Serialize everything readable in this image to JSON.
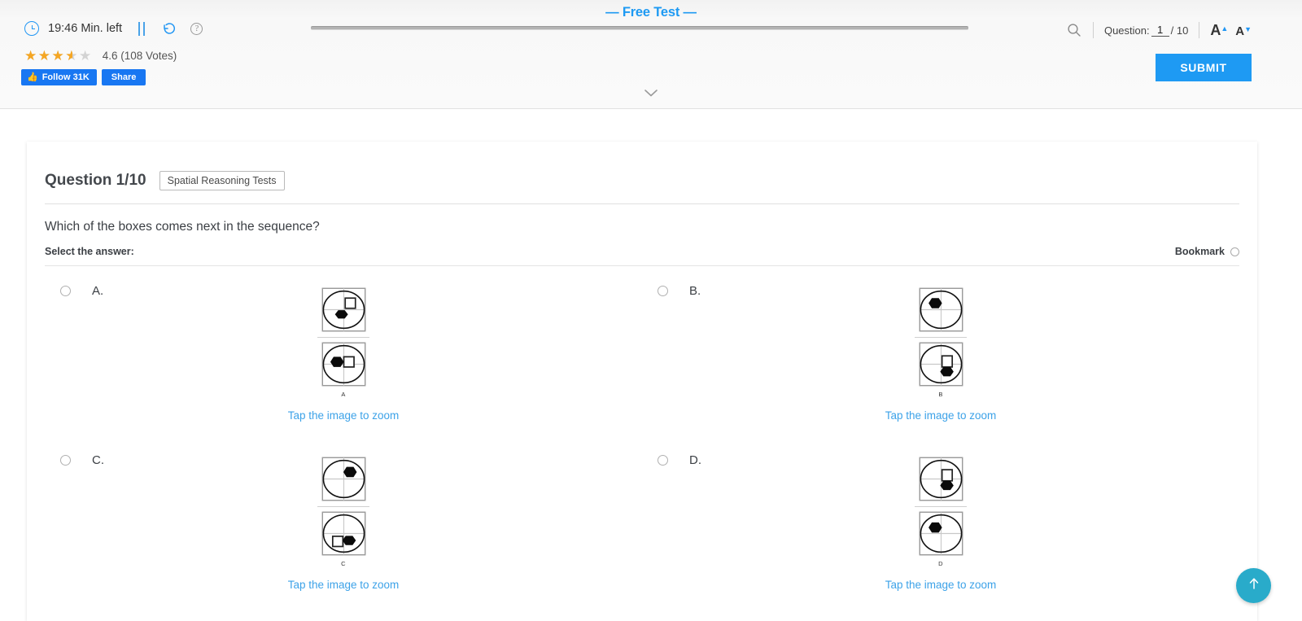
{
  "header": {
    "timer": "19:46 Min. left",
    "clock_icon": "clock-icon",
    "pause_icon": "pause-icon",
    "reset_icon": "reset-icon",
    "help_icon": "help-icon",
    "title": "— Free Test —",
    "search_icon": "search-icon",
    "question_label": "Question:",
    "question_current": "1",
    "question_total": "/ 10",
    "font_increase": "A",
    "font_decrease": "A",
    "rating_value": "4.6",
    "rating_votes": "(108 Votes)",
    "rating_stars": 3.5,
    "follow_label": "Follow 31K",
    "share_label": "Share",
    "submit_label": "SUBMIT",
    "collapse_icon": "chevron-down-icon",
    "accent_color": "#1e9af3",
    "star_color": "#f5a623",
    "facebook_color": "#1877f2"
  },
  "question": {
    "heading": "Question 1/10",
    "tag": "Spatial Reasoning Tests",
    "prompt": "Which of the boxes comes next in the sequence?",
    "select_label": "Select the answer:",
    "bookmark_label": "Bookmark"
  },
  "options": [
    {
      "letter": "A.",
      "caption": "A",
      "zoom_hint": "Tap the image to zoom"
    },
    {
      "letter": "B.",
      "caption": "B",
      "zoom_hint": "Tap the image to zoom"
    },
    {
      "letter": "C.",
      "caption": "C",
      "zoom_hint": "Tap the image to zoom"
    },
    {
      "letter": "D.",
      "caption": "D",
      "zoom_hint": "Tap the image to zoom"
    }
  ],
  "footer": {
    "scroll_top_icon": "arrow-up-icon",
    "scroll_top_color": "#29abca"
  }
}
